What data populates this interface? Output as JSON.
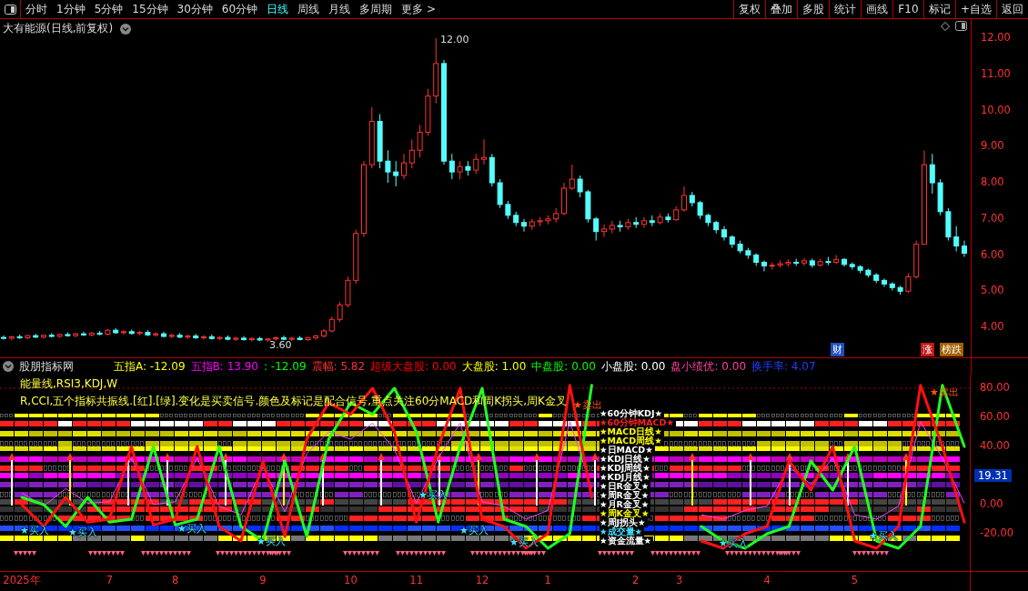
{
  "toolbar": {
    "periods": [
      {
        "label": "分时",
        "selected": false
      },
      {
        "label": "1分钟",
        "selected": false
      },
      {
        "label": "5分钟",
        "selected": false
      },
      {
        "label": "15分钟",
        "selected": false
      },
      {
        "label": "30分钟",
        "selected": false
      },
      {
        "label": "60分钟",
        "selected": false
      },
      {
        "label": "日线",
        "selected": true
      },
      {
        "label": "周线",
        "selected": false
      },
      {
        "label": "月线",
        "selected": false
      },
      {
        "label": "多周期",
        "selected": false
      },
      {
        "label": "更多 >",
        "selected": false
      }
    ],
    "buttons": [
      "复权",
      "叠加",
      "多股",
      "统计",
      "画线",
      "F10",
      "标记",
      "+自选",
      "返回"
    ]
  },
  "price_chart": {
    "title": "大有能源(日线,前复权)",
    "high_label": "12.00",
    "low_label": "3.60",
    "chart_data": {
      "type": "candlestick",
      "ylim": [
        3.17,
        12.53
      ],
      "yticks": [
        {
          "value": 12,
          "label": "12.00"
        },
        {
          "value": 11,
          "label": "11.00"
        },
        {
          "value": 10,
          "label": "10.00"
        },
        {
          "value": 9,
          "label": "9.00"
        },
        {
          "value": 8,
          "label": "8.00"
        },
        {
          "value": 7,
          "label": "7.00"
        },
        {
          "value": 6,
          "label": "6.00"
        },
        {
          "value": 5,
          "label": "5.00"
        },
        {
          "value": 4,
          "label": "4.00"
        }
      ],
      "ohlc": [
        [
          3.72,
          3.78,
          3.66,
          3.7
        ],
        [
          3.7,
          3.76,
          3.64,
          3.74
        ],
        [
          3.74,
          3.8,
          3.68,
          3.71
        ],
        [
          3.71,
          3.79,
          3.67,
          3.77
        ],
        [
          3.77,
          3.82,
          3.7,
          3.73
        ],
        [
          3.73,
          3.8,
          3.69,
          3.78
        ],
        [
          3.78,
          3.84,
          3.72,
          3.75
        ],
        [
          3.75,
          3.83,
          3.71,
          3.8
        ],
        [
          3.8,
          3.86,
          3.74,
          3.77
        ],
        [
          3.77,
          3.85,
          3.73,
          3.82
        ],
        [
          3.82,
          3.88,
          3.76,
          3.79
        ],
        [
          3.79,
          3.87,
          3.75,
          3.84
        ],
        [
          3.84,
          3.9,
          3.78,
          3.81
        ],
        [
          3.81,
          3.95,
          3.78,
          3.92
        ],
        [
          3.92,
          3.98,
          3.82,
          3.85
        ],
        [
          3.85,
          3.92,
          3.8,
          3.88
        ],
        [
          3.88,
          3.94,
          3.8,
          3.83
        ],
        [
          3.83,
          3.9,
          3.78,
          3.86
        ],
        [
          3.86,
          3.92,
          3.76,
          3.79
        ],
        [
          3.79,
          3.86,
          3.74,
          3.82
        ],
        [
          3.82,
          3.88,
          3.72,
          3.75
        ],
        [
          3.75,
          3.82,
          3.7,
          3.78
        ],
        [
          3.78,
          3.84,
          3.7,
          3.73
        ],
        [
          3.73,
          3.8,
          3.68,
          3.76
        ],
        [
          3.76,
          3.82,
          3.68,
          3.71
        ],
        [
          3.71,
          3.78,
          3.66,
          3.74
        ],
        [
          3.74,
          3.8,
          3.66,
          3.69
        ],
        [
          3.69,
          3.76,
          3.64,
          3.72
        ],
        [
          3.72,
          3.78,
          3.64,
          3.67
        ],
        [
          3.67,
          3.74,
          3.62,
          3.7
        ],
        [
          3.7,
          3.76,
          3.63,
          3.66
        ],
        [
          3.66,
          3.73,
          3.61,
          3.69
        ],
        [
          3.69,
          3.74,
          3.62,
          3.65
        ],
        [
          3.65,
          3.7,
          3.6,
          3.68
        ],
        [
          3.68,
          3.75,
          3.63,
          3.71
        ],
        [
          3.71,
          3.77,
          3.64,
          3.67
        ],
        [
          3.67,
          3.74,
          3.62,
          3.7
        ],
        [
          3.7,
          3.76,
          3.64,
          3.66
        ],
        [
          3.66,
          3.74,
          3.62,
          3.71
        ],
        [
          3.71,
          3.8,
          3.66,
          3.76
        ],
        [
          3.76,
          3.95,
          3.72,
          3.9
        ],
        [
          3.9,
          4.3,
          3.86,
          4.22
        ],
        [
          4.22,
          4.7,
          4.15,
          4.62
        ],
        [
          4.62,
          5.4,
          4.55,
          5.3
        ],
        [
          5.3,
          6.7,
          5.2,
          6.6
        ],
        [
          6.6,
          8.6,
          6.5,
          8.5
        ],
        [
          8.5,
          10.1,
          8.4,
          9.7
        ],
        [
          9.7,
          9.9,
          8.4,
          8.6
        ],
        [
          8.6,
          8.9,
          8.0,
          8.3
        ],
        [
          8.3,
          8.6,
          7.9,
          8.2
        ],
        [
          8.2,
          8.8,
          8.1,
          8.55
        ],
        [
          8.55,
          9.2,
          8.4,
          8.9
        ],
        [
          8.9,
          9.6,
          8.7,
          9.4
        ],
        [
          9.4,
          10.6,
          9.3,
          10.4
        ],
        [
          10.4,
          12.0,
          10.2,
          11.3
        ],
        [
          11.3,
          11.4,
          8.5,
          8.6
        ],
        [
          8.6,
          8.8,
          8.1,
          8.3
        ],
        [
          8.3,
          8.6,
          8.1,
          8.45
        ],
        [
          8.45,
          8.6,
          8.2,
          8.35
        ],
        [
          8.35,
          8.8,
          8.25,
          8.65
        ],
        [
          8.65,
          9.2,
          8.5,
          8.7
        ],
        [
          8.7,
          8.8,
          7.9,
          8.0
        ],
        [
          8.0,
          8.1,
          7.3,
          7.4
        ],
        [
          7.4,
          7.5,
          7.0,
          7.1
        ],
        [
          7.1,
          7.2,
          6.8,
          6.9
        ],
        [
          6.9,
          7.0,
          6.65,
          6.8
        ],
        [
          6.8,
          7.0,
          6.7,
          6.92
        ],
        [
          6.92,
          7.05,
          6.8,
          6.95
        ],
        [
          6.95,
          7.1,
          6.85,
          7.0
        ],
        [
          7.0,
          7.3,
          6.9,
          7.15
        ],
        [
          7.15,
          8.0,
          7.1,
          7.85
        ],
        [
          7.85,
          8.5,
          7.8,
          8.1
        ],
        [
          8.1,
          8.2,
          7.6,
          7.75
        ],
        [
          7.75,
          7.8,
          6.9,
          7.0
        ],
        [
          7.0,
          7.05,
          6.4,
          6.65
        ],
        [
          6.65,
          6.85,
          6.5,
          6.72
        ],
        [
          6.72,
          6.95,
          6.6,
          6.82
        ],
        [
          6.82,
          6.95,
          6.65,
          6.78
        ],
        [
          6.78,
          7.0,
          6.7,
          6.9
        ],
        [
          6.9,
          7.05,
          6.75,
          6.85
        ],
        [
          6.85,
          7.05,
          6.75,
          6.95
        ],
        [
          6.95,
          7.1,
          6.8,
          6.9
        ],
        [
          6.9,
          7.15,
          6.85,
          7.05
        ],
        [
          7.05,
          7.15,
          6.9,
          6.98
        ],
        [
          6.98,
          7.35,
          6.95,
          7.25
        ],
        [
          7.25,
          7.9,
          7.2,
          7.65
        ],
        [
          7.65,
          7.75,
          7.35,
          7.45
        ],
        [
          7.45,
          7.5,
          7.0,
          7.1
        ],
        [
          7.1,
          7.15,
          6.8,
          6.9
        ],
        [
          6.9,
          6.95,
          6.6,
          6.7
        ],
        [
          6.7,
          6.8,
          6.4,
          6.5
        ],
        [
          6.5,
          6.55,
          6.2,
          6.3
        ],
        [
          6.3,
          6.4,
          6.05,
          6.12
        ],
        [
          6.12,
          6.2,
          5.9,
          6.0
        ],
        [
          6.0,
          6.05,
          5.7,
          5.8
        ],
        [
          5.8,
          5.85,
          5.55,
          5.7
        ],
        [
          5.7,
          5.8,
          5.6,
          5.72
        ],
        [
          5.72,
          5.85,
          5.65,
          5.76
        ],
        [
          5.76,
          5.88,
          5.68,
          5.8
        ],
        [
          5.8,
          5.9,
          5.7,
          5.78
        ],
        [
          5.78,
          5.92,
          5.7,
          5.84
        ],
        [
          5.84,
          5.9,
          5.65,
          5.72
        ],
        [
          5.72,
          5.9,
          5.68,
          5.82
        ],
        [
          5.82,
          5.95,
          5.72,
          5.8
        ],
        [
          5.8,
          6.0,
          5.75,
          5.88
        ],
        [
          5.88,
          5.92,
          5.68,
          5.74
        ],
        [
          5.74,
          5.8,
          5.6,
          5.68
        ],
        [
          5.68,
          5.72,
          5.5,
          5.58
        ],
        [
          5.58,
          5.62,
          5.38,
          5.45
        ],
        [
          5.45,
          5.5,
          5.22,
          5.3
        ],
        [
          5.3,
          5.35,
          5.12,
          5.2
        ],
        [
          5.2,
          5.25,
          5.02,
          5.1
        ],
        [
          5.1,
          5.15,
          4.9,
          5.0
        ],
        [
          5.0,
          5.5,
          4.95,
          5.4
        ],
        [
          5.4,
          6.4,
          5.35,
          6.3
        ],
        [
          6.3,
          8.9,
          6.3,
          8.5
        ],
        [
          8.5,
          8.8,
          7.7,
          8.0
        ],
        [
          8.0,
          8.1,
          7.1,
          7.2
        ],
        [
          7.2,
          7.3,
          6.4,
          6.5
        ],
        [
          6.5,
          6.8,
          6.1,
          6.25
        ],
        [
          6.25,
          6.4,
          5.95,
          6.05
        ]
      ]
    },
    "markers": [
      {
        "text": "财",
        "color": "#2050c0"
      },
      {
        "text": "涨",
        "color": "#c01818"
      },
      {
        "text": "榜跌",
        "color": "#a06000"
      }
    ]
  },
  "indicator": {
    "name": "股朋指标网",
    "readouts": [
      {
        "text": "五指A: -12.09",
        "color": "#ffff00"
      },
      {
        "text": "五指B: 13.90",
        "color": "#ff00ff"
      },
      {
        "text": ": -12.09",
        "color": "#00ff00"
      },
      {
        "text": "震幅: 5.82",
        "color": "#ff3232"
      },
      {
        "text": "超级大盘股: 0.00",
        "color": "#ff0000"
      },
      {
        "text": "大盘股: 1.00",
        "color": "#ffff00"
      },
      {
        "text": "中盘股: 0.00",
        "color": "#00ff00"
      },
      {
        "text": "小盘股: 0.00",
        "color": "#ffffff"
      },
      {
        "text": "盘小绩优: 0.00",
        "color": "#ff40a0"
      },
      {
        "text": "换手率: 4.07",
        "color": "#2040ff"
      }
    ],
    "notes": [
      "能量线,RSI3,KDJ,W",
      "R,CCI,五个指标共振线.[红].[绿].变化是买卖信号.颜色及标记是配合信号,重点关注60分MACD和周K拐头,周K金叉"
    ],
    "signal_labels": [
      {
        "text": "★60分钟KDJ★",
        "color": "#ffffff"
      },
      {
        "text": "★60分钟MACD★",
        "color": "#ff2020"
      },
      {
        "text": "★MACD日线★",
        "color": "#ffff00"
      },
      {
        "text": "★MACD周线★",
        "color": "#ffff00"
      },
      {
        "text": "★日MACD★",
        "color": "#ffffff"
      },
      {
        "text": "★KDJ日线★",
        "color": "#ffffff"
      },
      {
        "text": "★KDJ周线★",
        "color": "#ffffff"
      },
      {
        "text": "★KDJ月线★",
        "color": "#ffffff"
      },
      {
        "text": "★日R金叉★",
        "color": "#ffffff"
      },
      {
        "text": "★周R金叉★",
        "color": "#ffffff"
      },
      {
        "text": "★月R金叉★",
        "color": "#ffffff"
      },
      {
        "text": "★周K金叉★",
        "color": "#ffff00"
      },
      {
        "text": "★周J拐头★",
        "color": "#ffffff"
      },
      {
        "text": "★成交量★",
        "color": "#40e0ff"
      },
      {
        "text": "★资金流量★",
        "color": "#ffffff"
      }
    ],
    "signals": [
      {
        "kind": "sell",
        "text": "★卖出"
      },
      {
        "kind": "sell",
        "text": "★卖出"
      },
      {
        "kind": "buy",
        "text": "★买入"
      },
      {
        "kind": "buy",
        "text": "★买入"
      },
      {
        "kind": "buy",
        "text": "★买入"
      },
      {
        "kind": "buy",
        "text": "★买入"
      },
      {
        "kind": "buy",
        "text": "★买入"
      },
      {
        "kind": "buy",
        "text": "★买入"
      },
      {
        "kind": "buy",
        "text": "★买入"
      },
      {
        "kind": "buy",
        "text": "★买入"
      },
      {
        "kind": "buy",
        "text": "★买入"
      }
    ],
    "chart_data": {
      "type": "line",
      "ylim": [
        -46.25,
        89.375
      ],
      "categories": [
        "2025年",
        null,
        null,
        null,
        "7",
        null,
        null,
        "8",
        null,
        null,
        null,
        "9",
        null,
        null,
        null,
        "10",
        null,
        null,
        "11",
        null,
        null,
        "12",
        null,
        null,
        "1",
        null,
        null,
        null,
        "2",
        null,
        "3",
        null,
        null,
        null,
        "4",
        null,
        null,
        null,
        "5",
        null,
        null,
        null,
        null,
        null
      ],
      "yticks": [
        {
          "value": 80,
          "label": "80.00"
        },
        {
          "value": 60,
          "label": "60.00"
        },
        {
          "value": 40,
          "label": "40.00"
        },
        {
          "value": 0,
          "label": "0.00"
        },
        {
          "value": -20,
          "label": "-20.00"
        }
      ],
      "series": [
        {
          "color": "#ff1010",
          "values": [
            0,
            -15,
            5,
            -12,
            -10,
            40,
            -14,
            -10,
            40,
            -15,
            -25,
            30,
            -22,
            45,
            70,
            62,
            80,
            50,
            -12,
            40,
            80,
            -10,
            -15,
            -30,
            -20,
            82,
            5,
            null,
            null,
            null,
            null,
            -25,
            -30,
            -20,
            -15,
            30,
            10,
            40,
            -25,
            -30,
            -15,
            82,
            40,
            -12
          ]
        },
        {
          "color": "#20ff20",
          "values": [
            5,
            0,
            -15,
            5,
            -12,
            -10,
            40,
            -14,
            -10,
            40,
            -15,
            -25,
            30,
            -22,
            45,
            70,
            62,
            80,
            50,
            -12,
            40,
            80,
            -10,
            -15,
            -30,
            -20,
            82,
            null,
            null,
            null,
            null,
            -15,
            -25,
            -30,
            -20,
            -15,
            30,
            10,
            40,
            -25,
            -30,
            -15,
            82,
            40
          ]
        },
        {
          "color": "#ff40ff",
          "values": [
            8,
            -1,
            11,
            1,
            2,
            32,
            0,
            2,
            32,
            -1,
            -7,
            26,
            -5,
            35,
            50,
            45,
            56,
            38,
            1,
            32,
            56,
            2,
            -1,
            -10,
            -4,
            57,
            11,
            null,
            null,
            null,
            null,
            -7,
            -10,
            -4,
            -1,
            26,
            14,
            32,
            -7,
            -10,
            -1,
            57,
            32,
            1
          ]
        }
      ]
    },
    "current_value": "19.31"
  }
}
